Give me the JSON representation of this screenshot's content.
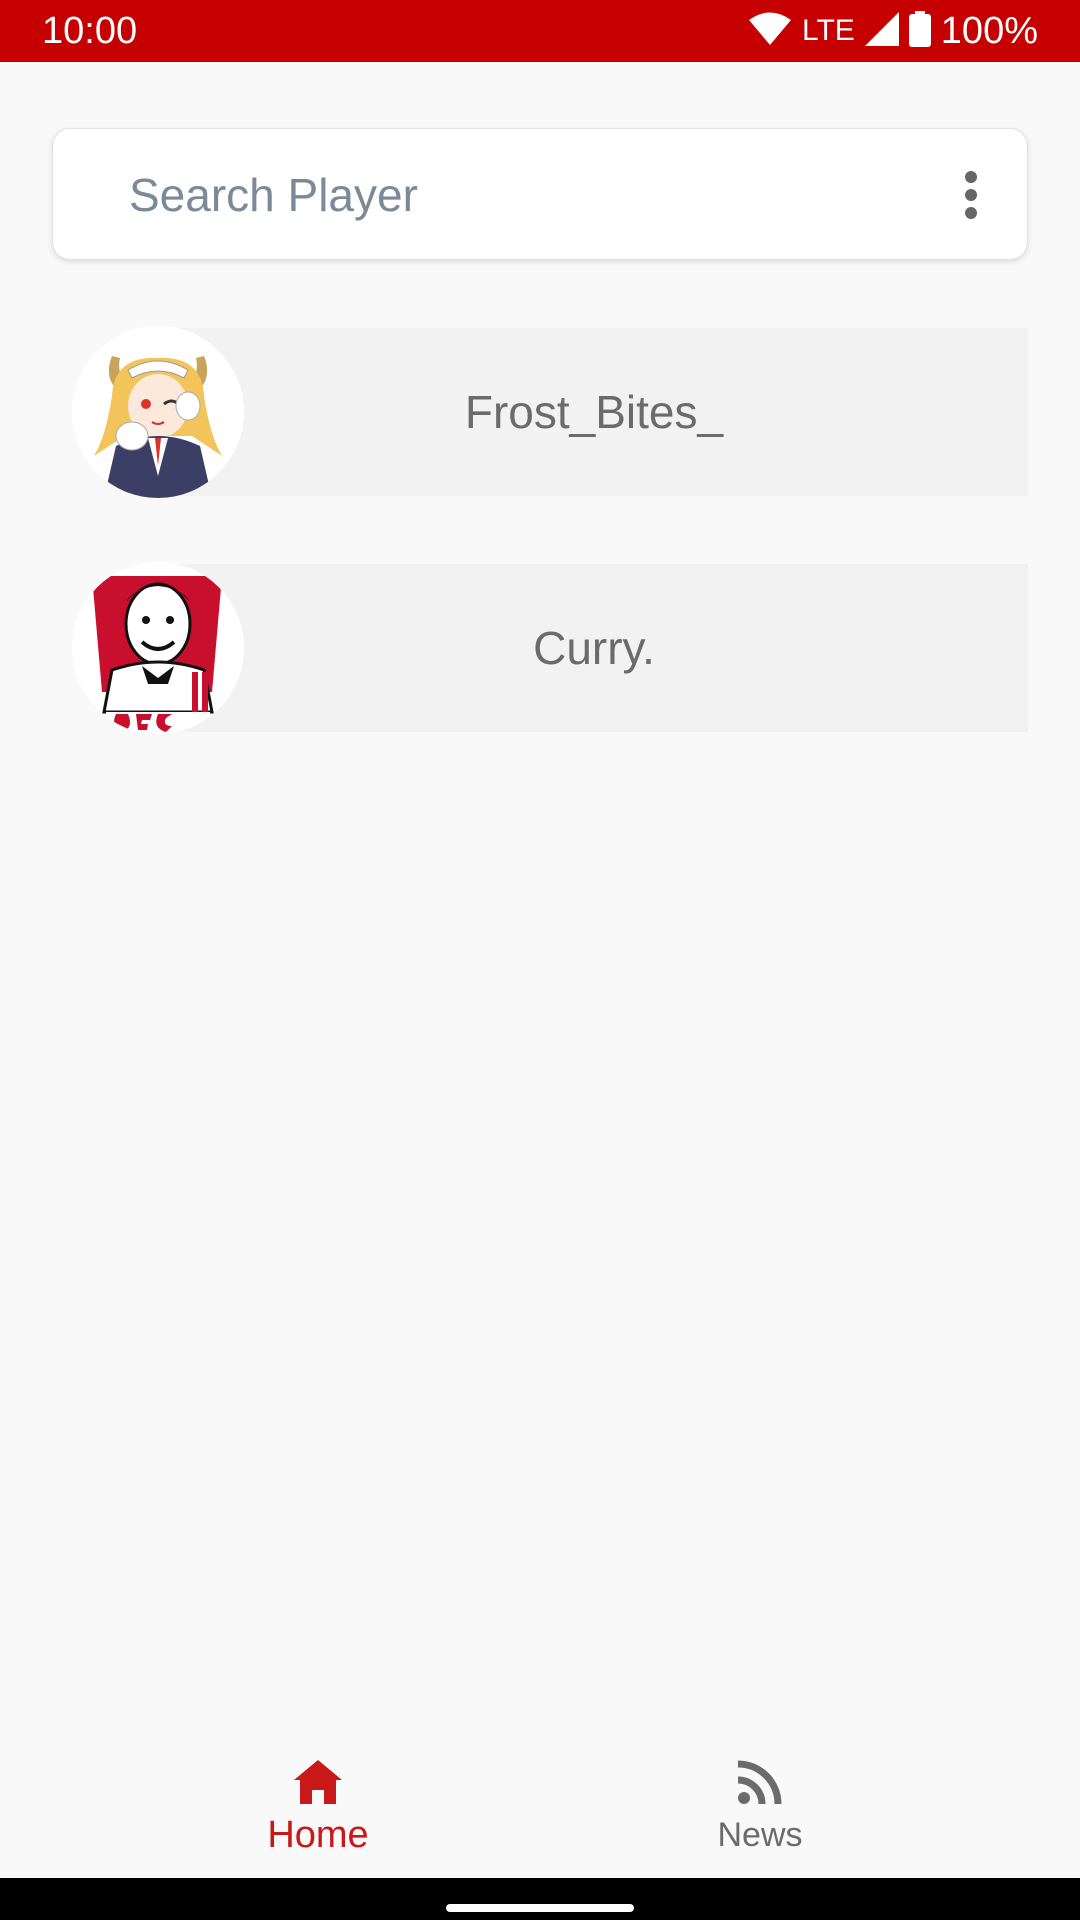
{
  "status_bar": {
    "time": "10:00",
    "network": "LTE",
    "battery": "100%",
    "wifi_icon": "wifi-icon",
    "signal_icon": "cell-signal-icon",
    "battery_icon": "battery-icon"
  },
  "search": {
    "placeholder": "Search Player",
    "value": "",
    "menu_icon": "more-vert-icon"
  },
  "players": [
    {
      "name": "Frost_Bites_",
      "avatar": "anime-maid-avatar"
    },
    {
      "name": "Curry.",
      "avatar": "kfc-colonel-avatar"
    }
  ],
  "bottom_nav": {
    "items": [
      {
        "label": "Home",
        "icon": "home-icon",
        "active": true
      },
      {
        "label": "News",
        "icon": "rss-feed-icon",
        "active": false
      }
    ]
  },
  "colors": {
    "accent": "#c60000",
    "active_nav": "#c81818",
    "inactive_nav": "#6b6b6b",
    "row_background": "#f2f2f2"
  }
}
